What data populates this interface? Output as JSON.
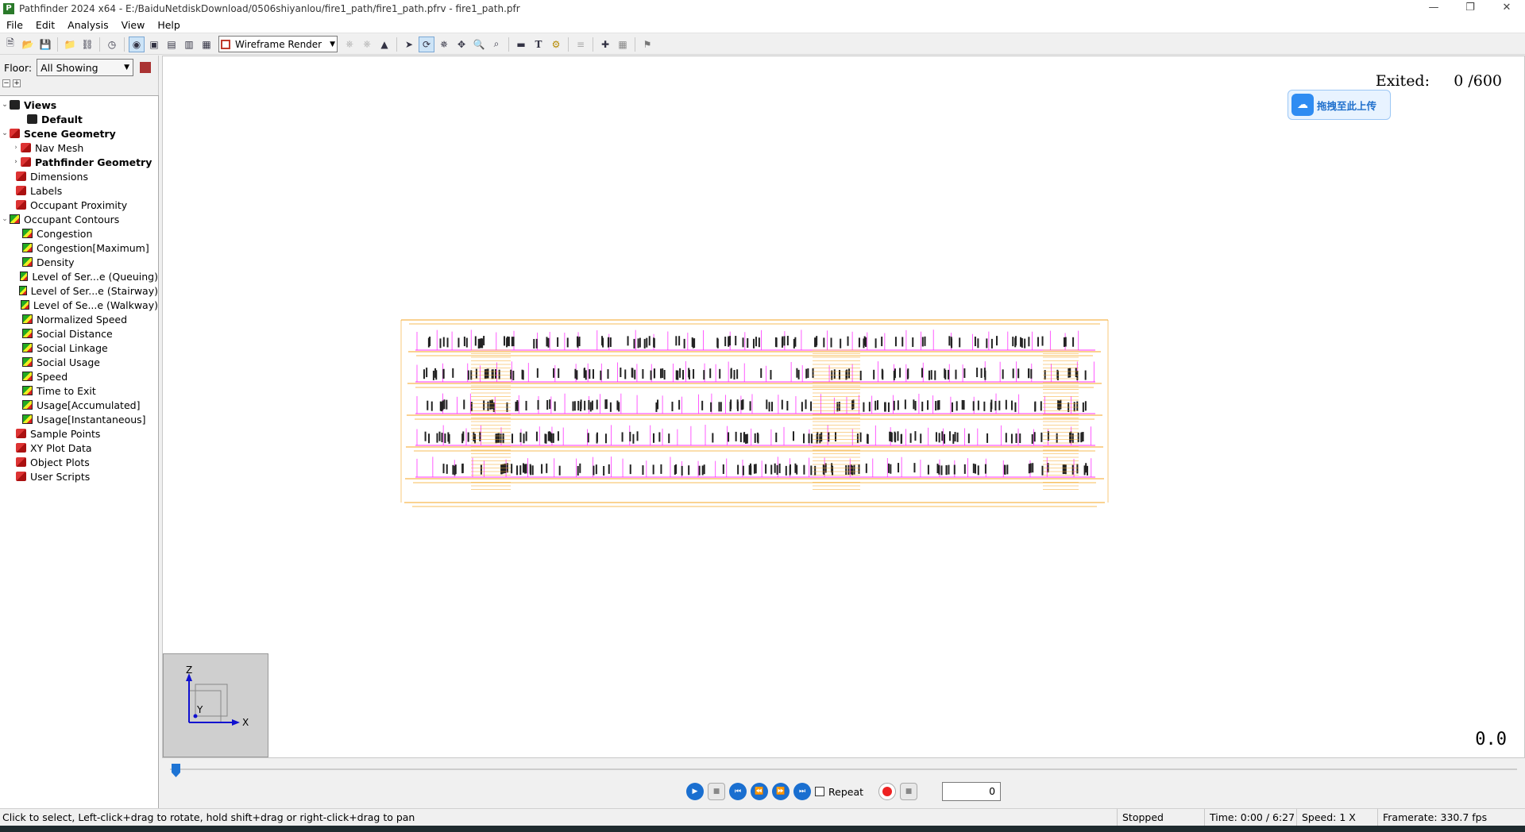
{
  "window": {
    "title": "Pathfinder 2024 x64 - E:/BaiduNetdiskDownload/0506shiyanlou/fire1_path/fire1_path.pfrv - fire1_path.pfr",
    "app_icon": "app-logo-icon",
    "controls": [
      "minimize-icon",
      "restore-icon",
      "close-icon"
    ]
  },
  "menu": {
    "items": [
      "File",
      "Edit",
      "Analysis",
      "View",
      "Help"
    ]
  },
  "toolbar": {
    "render_mode": "Wireframe Render"
  },
  "sidebar": {
    "floor_label": "Floor:",
    "floor_value": "All Showing",
    "tree": [
      {
        "label": "Views",
        "bold": true,
        "icon": "views-icon"
      },
      {
        "label": "Default",
        "bold": true,
        "icon": "camera-icon"
      },
      {
        "label": "Scene Geometry",
        "bold": true,
        "icon": "geometry-icon"
      },
      {
        "label": "Nav Mesh",
        "icon": "geometry-icon"
      },
      {
        "label": "Pathfinder Geometry",
        "bold": true,
        "icon": "geometry-icon"
      },
      {
        "label": "Dimensions",
        "icon": "geometry-icon"
      },
      {
        "label": "Labels",
        "icon": "geometry-icon"
      },
      {
        "label": "Occupant Proximity",
        "icon": "geometry-icon"
      },
      {
        "label": "Occupant Contours",
        "icon": "contour-icon"
      },
      {
        "label": "Congestion",
        "icon": "contour-icon"
      },
      {
        "label": "Congestion[Maximum]",
        "icon": "contour-icon"
      },
      {
        "label": "Density",
        "icon": "contour-icon"
      },
      {
        "label": "Level of Ser...e (Queuing)",
        "icon": "contour-icon"
      },
      {
        "label": "Level of Ser...e (Stairway)",
        "icon": "contour-icon"
      },
      {
        "label": "Level of Se...e (Walkway)",
        "icon": "contour-icon"
      },
      {
        "label": "Normalized Speed",
        "icon": "contour-icon"
      },
      {
        "label": "Social Distance",
        "icon": "contour-icon"
      },
      {
        "label": "Social Linkage",
        "icon": "contour-icon"
      },
      {
        "label": "Social Usage",
        "icon": "contour-icon"
      },
      {
        "label": "Speed",
        "icon": "contour-icon"
      },
      {
        "label": "Time to Exit",
        "icon": "contour-icon"
      },
      {
        "label": "Usage[Accumulated]",
        "icon": "contour-icon"
      },
      {
        "label": "Usage[Instantaneous]",
        "icon": "contour-icon"
      },
      {
        "label": "Sample Points",
        "icon": "geometry-icon"
      },
      {
        "label": "XY Plot Data",
        "icon": "geometry-icon"
      },
      {
        "label": "Object Plots",
        "icon": "geometry-icon"
      },
      {
        "label": "User Scripts",
        "icon": "geometry-icon"
      }
    ]
  },
  "viewport": {
    "exited_label": "Exited:",
    "exited_value": "0 /600",
    "baidu_upload": "拖拽至此上传",
    "axis_z": "Z",
    "axis_y": "Y",
    "axis_x": "X",
    "fps_readout": "0.0",
    "colors": {
      "wireframe": "#f5a623",
      "walls": "#ff33ff",
      "occupants": "#222222"
    }
  },
  "playback": {
    "repeat_label": "Repeat",
    "frame_value": "0",
    "timeline_progress": 0.0
  },
  "status": {
    "hint": "Click to select, Left-click+drag to rotate, hold shift+drag or right-click+drag to pan",
    "state": "Stopped",
    "time": "Time: 0:00 / 6:27",
    "speed": "Speed: 1 X",
    "framerate": "Framerate: 330.7 fps"
  }
}
